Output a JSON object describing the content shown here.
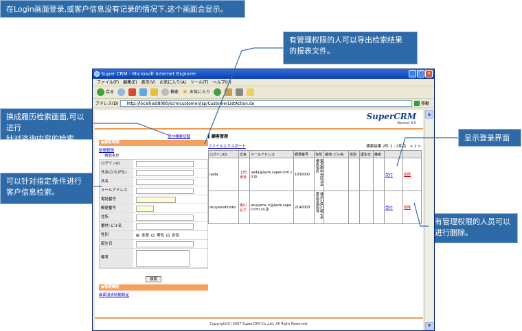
{
  "callouts": {
    "top": "在Login画面登录,或客户信息没有记录的情况下,这个画面会显示。",
    "export": "有管理权限的人可以导出检索结果\n的报表文件。",
    "history": "换成履历检索画面,可以进行\n针对咨询内容的检索。",
    "search": "可以针对指定条件进行\n客户信息检索。",
    "login": "显示登录界面",
    "delete": "有管理权限的人员可以\n进行删除。"
  },
  "browser": {
    "title": "Super CRM - Microsoft Internet Explorer",
    "menu": [
      "ファイル(F)",
      "編集(E)",
      "表示(V)",
      "お気に入り(A)",
      "ツール(T)",
      "ヘルプ(H)"
    ],
    "toolbar": {
      "back": "戻る",
      "search": "検索",
      "favorites": "お気に入り"
    },
    "address_label": "アドレス(D)",
    "url": "http://localhost8080/scrmcustomer/jsp/CustomerListAction.do",
    "go": "移動"
  },
  "app": {
    "logo": "SuperCRM",
    "version": "Version 3.0",
    "history_switch": "受付検索切替",
    "left": {
      "customer_section": "●顧客情報",
      "new_register": "新規登録",
      "search_conditions": "検索条件",
      "fields": [
        {
          "label": "ログインID",
          "input": "normal"
        },
        {
          "label": "氏名(ひらがな)",
          "input": "normal"
        },
        {
          "label": "氏名",
          "input": "normal"
        },
        {
          "label": "メールアドレス",
          "input": "normal"
        },
        {
          "label": "電話番号",
          "input": "short"
        },
        {
          "label": "郵便番号",
          "input": "tiny"
        },
        {
          "label": "住所",
          "input": "normal"
        },
        {
          "label": "番地･ビル名",
          "input": "normal"
        }
      ],
      "gender_label": "性別",
      "gender_options": [
        "全部",
        "男性",
        "女性"
      ],
      "birthday_label": "誕生日",
      "notes_label": "備考",
      "search_button": "検索",
      "manage_section": "●管理機能",
      "password_setting": "画面消去時間設定"
    },
    "results": {
      "title": "顧客管理",
      "file_export": "ファイルエクスポート",
      "count_text": "検索結果 2件 1 - 2件目　< 1 >",
      "headers": [
        "ログインID",
        "氏名",
        "メールアドレス",
        "郵便番号",
        "住所",
        "番地･ビル名",
        "性別",
        "誕生日",
        "備考",
        "",
        ""
      ],
      "rows": [
        {
          "login": "ueda",
          "name": "上田 孝道",
          "email": "ueda@lavie.super-crm.co.jp",
          "zip": "1030002",
          "address": "東京都中央区日本橋馬喰町",
          "accept": "受付",
          "delete": "削除"
        },
        {
          "login": "okuyamahiroko",
          "name": "奥山 弘子",
          "email": "okuyama_h@lavie.super-crm.co.jp",
          "zip": "2140003",
          "address": "神奈川県川崎市多摩区菅稲田堤",
          "accept": "受付",
          "delete": "削除"
        }
      ]
    },
    "footer": "Copyright(C) 2007 SuperCRM Co.,Ltd. All Right Reserved."
  },
  "colors": {
    "callout_bg": "#2e6aa8",
    "accent_orange": "#f3a062",
    "logo_blue": "#1a3e93",
    "delete_red": "#cc0000"
  }
}
